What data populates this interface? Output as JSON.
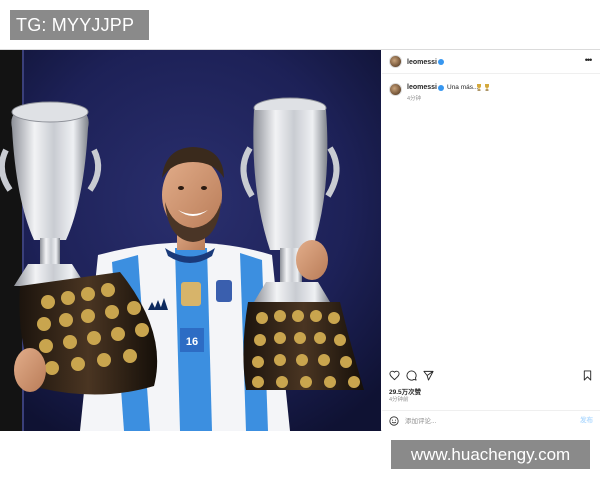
{
  "watermark_top": {
    "text": "TG: MYYJJPP"
  },
  "watermark_bottom": {
    "text": "www.huachengy.com"
  },
  "post": {
    "photo": {
      "jersey_number": "16"
    },
    "header": {
      "username": "leomessi",
      "avatar_icon": "profile-avatar",
      "more_icon": "more-horizontal-icon"
    },
    "caption": {
      "username": "leomessi",
      "text": "Una más...",
      "emojis": [
        "trophy-icon",
        "trophy-icon"
      ],
      "time": "4分钟"
    },
    "actions": {
      "like_icon": "heart-icon",
      "comment_icon": "comment-icon",
      "share_icon": "share-icon",
      "save_icon": "bookmark-icon"
    },
    "likes": "29.5万次赞",
    "time": "4分钟前",
    "comment": {
      "placeholder": "添加评论...",
      "post_label": "发布",
      "emoji_icon": "smiley-icon"
    },
    "colors": {
      "verified": "#3797f0",
      "post_button": "#b3dbff",
      "background_wall": "#1b1f4d"
    }
  }
}
